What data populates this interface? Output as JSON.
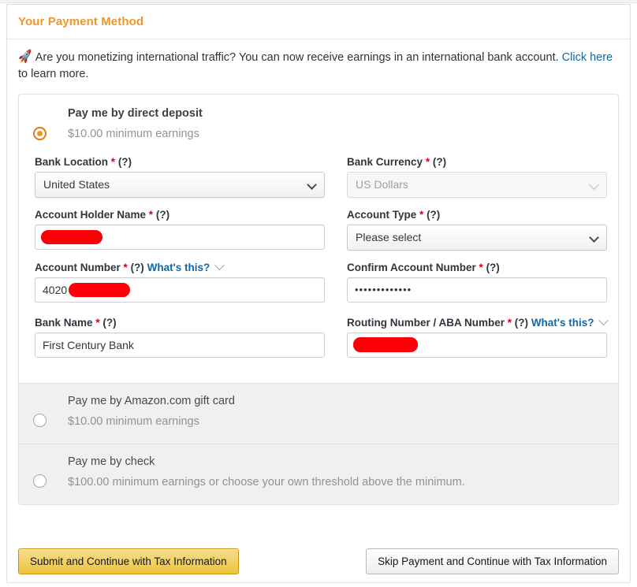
{
  "header": {
    "title": "Your Payment Method"
  },
  "banner": {
    "icon": "rocket-icon",
    "text_before": "Are you monetizing international traffic? You can now receive earnings in an international bank account. ",
    "link_text": "Click here",
    "text_after": " to learn more."
  },
  "options": [
    {
      "id": "direct-deposit",
      "title": "Pay me by direct deposit",
      "subtitle": "$10.00 minimum earnings",
      "selected": true
    },
    {
      "id": "gift-card",
      "title": "Pay me by Amazon.com gift card",
      "subtitle": "$10.00 minimum earnings",
      "selected": false
    },
    {
      "id": "check",
      "title": "Pay me by check",
      "subtitle": "$100.00 minimum earnings or choose your own threshold above the minimum.",
      "selected": false
    }
  ],
  "form": {
    "bank_location": {
      "label": "Bank Location",
      "required": "*",
      "help": "(?)",
      "value": "United States",
      "disabled": false
    },
    "bank_currency": {
      "label": "Bank Currency",
      "required": "*",
      "help": "(?)",
      "value": "US Dollars",
      "disabled": true
    },
    "account_holder_name": {
      "label": "Account Holder Name",
      "required": "*",
      "help": "(?)",
      "value": "",
      "redacted": true
    },
    "account_type": {
      "label": "Account Type",
      "required": "*",
      "help": "(?)",
      "value": "Please select",
      "disabled": false
    },
    "account_number": {
      "label": "Account Number",
      "required": "*",
      "help": "(?)",
      "whats_this": "What's this?",
      "value": "4020",
      "redacted": true
    },
    "confirm_account_number": {
      "label": "Confirm Account Number",
      "required": "*",
      "help": "(?)",
      "value": "•••••••••••••"
    },
    "bank_name": {
      "label": "Bank Name",
      "required": "*",
      "help": "(?)",
      "value": "First Century Bank"
    },
    "routing_number": {
      "label": "Routing Number / ABA Number",
      "required": "*",
      "help": "(?)",
      "whats_this": "What's this?",
      "value": "",
      "redacted": true
    }
  },
  "footer": {
    "submit_label": "Submit and Continue with Tax Information",
    "skip_label": "Skip Payment and Continue with Tax Information"
  },
  "colors": {
    "accent_orange": "#f0962c",
    "link_blue": "#1168a8",
    "required_red": "#d0021b",
    "redaction_red": "#fb0007",
    "primary_button": "#eec43a"
  }
}
